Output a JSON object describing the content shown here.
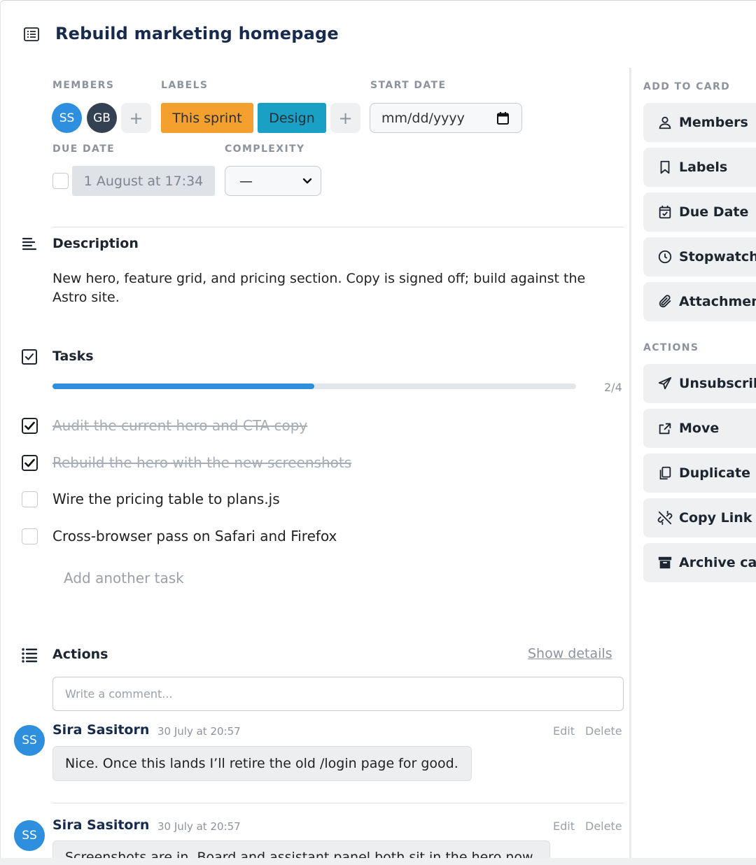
{
  "card": {
    "title": "Rebuild marketing homepage",
    "title_icon": "card-list-icon"
  },
  "fields": {
    "members_label": "MEMBERS",
    "labels_label": "LABELS",
    "start_date_label": "START DATE",
    "due_date_label": "DUE DATE",
    "complexity_label": "COMPLEXITY",
    "members": [
      {
        "initials": "SS",
        "color": "#2d8fde"
      },
      {
        "initials": "GB",
        "color": "#344153"
      }
    ],
    "add_member_symbol": "+",
    "labels": [
      {
        "text": "This sprint",
        "color": "#f3a02e"
      },
      {
        "text": "Design",
        "color": "#19a0c4"
      }
    ],
    "add_label_symbol": "+",
    "start_date_placeholder": "mm/dd/yyyy",
    "due_date_value": "1 August at 17:34",
    "due_date_checked": false,
    "complexity_value": "—"
  },
  "description": {
    "title": "Description",
    "text": "New hero, feature grid, and pricing section. Copy is signed off; build against the Astro site."
  },
  "tasks": {
    "title": "Tasks",
    "progress_text": "2/4",
    "progress_fraction": 0.5,
    "items": [
      {
        "text": "Audit the current hero and CTA copy",
        "done": true
      },
      {
        "text": "Rebuild the hero with the new screenshots",
        "done": true
      },
      {
        "text": "Wire the pricing table to plans.js",
        "done": false
      },
      {
        "text": "Cross-browser pass on Safari and Firefox",
        "done": false
      }
    ],
    "add_placeholder": "Add another task"
  },
  "actions": {
    "title": "Actions",
    "show_details": "Show details",
    "comment_placeholder": "Write a comment...",
    "comments": [
      {
        "initials": "SS",
        "author": "Sira Sasitorn",
        "time": "30 July at 20:57",
        "edit": "Edit",
        "delete": "Delete",
        "text": "Nice. Once this lands I’ll retire the old /login page for good."
      },
      {
        "initials": "SS",
        "author": "Sira Sasitorn",
        "time": "30 July at 20:57",
        "edit": "Edit",
        "delete": "Delete",
        "text": "Screenshots are in. Board and assistant panel both sit in the hero now."
      }
    ]
  },
  "sidebar": {
    "add_to_card_label": "ADD TO CARD",
    "add_to_card": [
      {
        "label": "Members",
        "icon": "user-icon"
      },
      {
        "label": "Labels",
        "icon": "bookmark-icon"
      },
      {
        "label": "Due Date",
        "icon": "calendar-check-icon"
      },
      {
        "label": "Stopwatch",
        "icon": "clock-icon"
      },
      {
        "label": "Attachment",
        "icon": "paperclip-icon"
      }
    ],
    "actions_label": "ACTIONS",
    "actions": [
      {
        "label": "Unsubscribe",
        "icon": "paper-plane-icon"
      },
      {
        "label": "Move",
        "icon": "share-icon"
      },
      {
        "label": "Duplicate",
        "icon": "copy-icon"
      },
      {
        "label": "Copy Link",
        "icon": "unlink-icon"
      },
      {
        "label": "Archive card",
        "icon": "archive-icon"
      }
    ]
  }
}
